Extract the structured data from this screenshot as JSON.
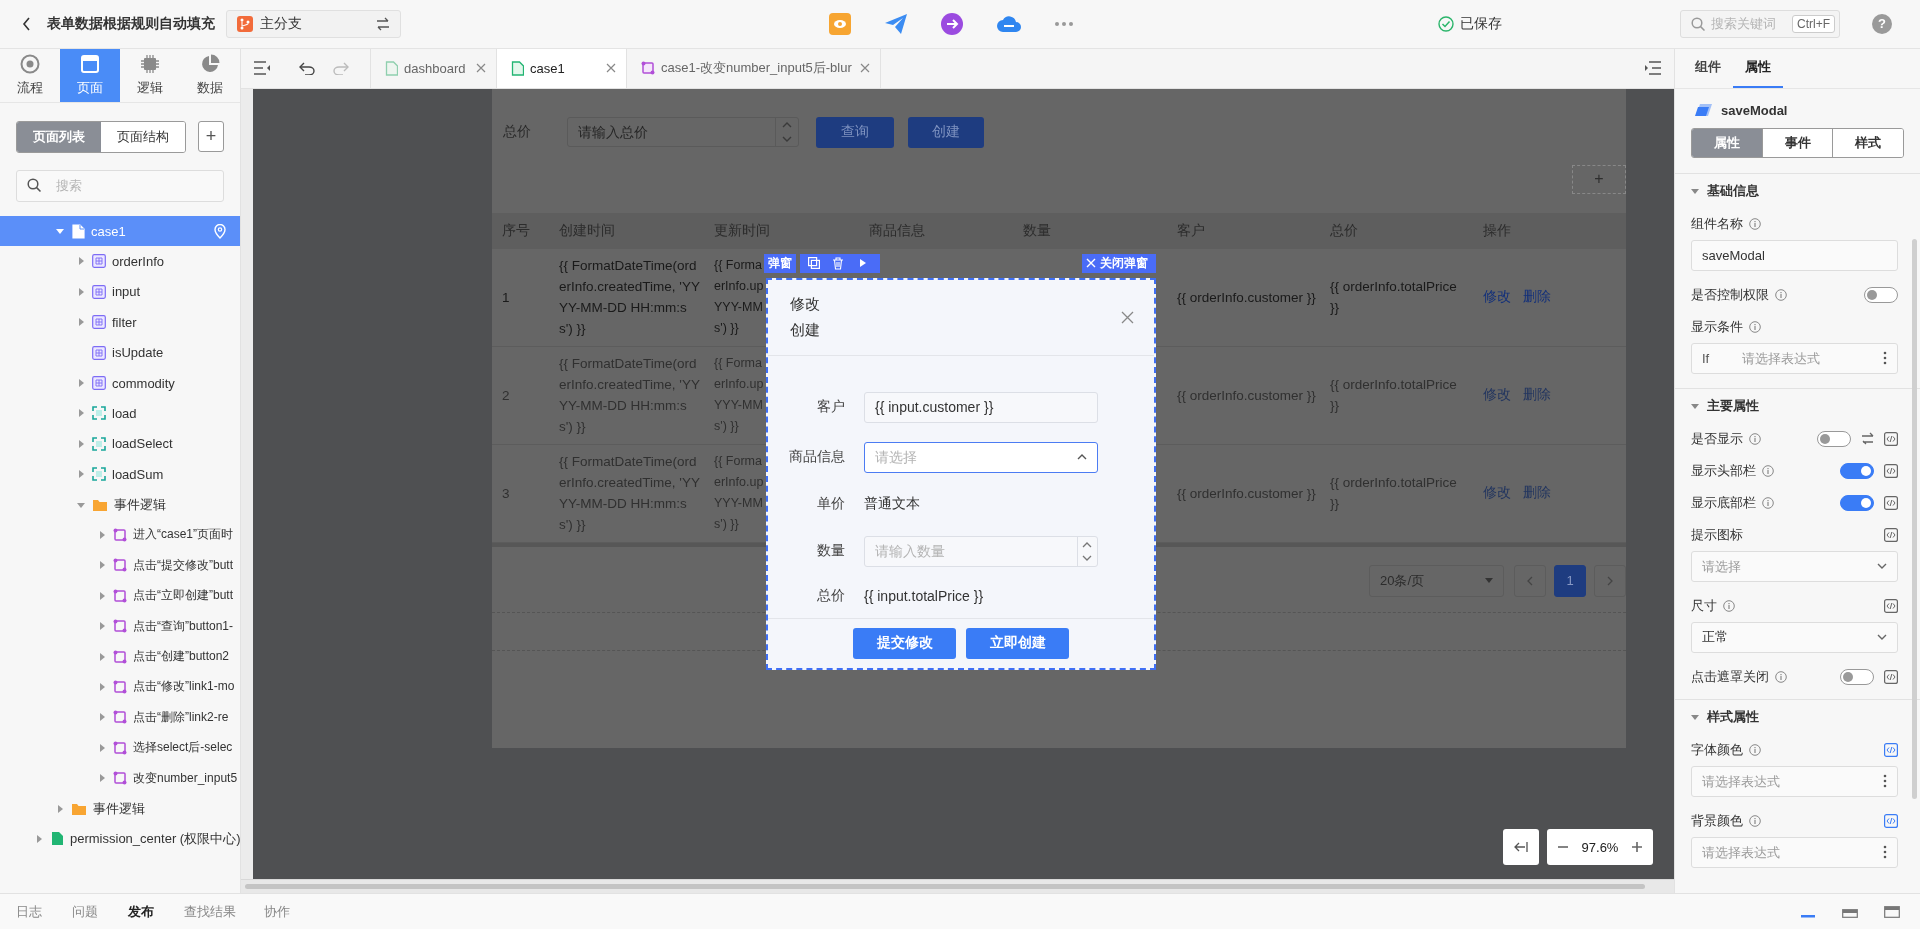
{
  "app_bar": {
    "title": "表单数据根据规则自动填充",
    "branch": "主分支",
    "save_status": "已保存",
    "search": {
      "placeholder": "搜索关键词",
      "shortcut": "Ctrl+F"
    },
    "help": "?"
  },
  "side_panel": {
    "nav_tabs": [
      {
        "label": "流程",
        "kind": "flow",
        "selected": false
      },
      {
        "label": "页面",
        "kind": "page",
        "selected": true
      },
      {
        "label": "逻辑",
        "kind": "logic",
        "selected": false
      },
      {
        "label": "数据",
        "kind": "data",
        "selected": false
      }
    ],
    "segments": [
      {
        "label": "页面列表",
        "selected": true
      },
      {
        "label": "页面结构",
        "selected": false
      }
    ],
    "add_button": "+",
    "search": {
      "placeholder": "搜索"
    },
    "tree": [
      {
        "children": [
          {
            "label": "case1",
            "kind": "page",
            "expanded": true,
            "selected": true,
            "children": [
              {
                "label": "orderInfo",
                "kind": "variable",
                "expanded": false,
                "selected": false
              },
              {
                "label": "input",
                "kind": "variable",
                "expanded": false,
                "selected": false
              },
              {
                "label": "filter",
                "kind": "variable",
                "expanded": false,
                "selected": false
              },
              {
                "label": "isUpdate",
                "kind": "variable",
                "selected": false
              },
              {
                "label": "commodity",
                "kind": "variable",
                "expanded": false,
                "selected": false
              },
              {
                "label": "load",
                "kind": "action",
                "expanded": false,
                "selected": false
              },
              {
                "label": "loadSelect",
                "kind": "action",
                "expanded": false,
                "selected": false
              },
              {
                "label": "loadSum",
                "kind": "action",
                "expanded": false,
                "selected": false
              },
              {
                "label": "事件逻辑",
                "kind": "folder",
                "expanded": true,
                "selected": false,
                "children": [
                  {
                    "label": "进入“case1”页面时",
                    "kind": "event",
                    "expanded": false,
                    "selected": false
                  },
                  {
                    "label": "点击“提交修改”butt",
                    "kind": "event",
                    "expanded": false,
                    "selected": false
                  },
                  {
                    "label": "点击“立即创建”butt",
                    "kind": "event",
                    "expanded": false,
                    "selected": false
                  },
                  {
                    "label": "点击“查询”button1-",
                    "kind": "event",
                    "expanded": false,
                    "selected": false
                  },
                  {
                    "label": "点击“创建”button2",
                    "kind": "event",
                    "expanded": false,
                    "selected": false
                  },
                  {
                    "label": "点击“修改”link1-mo",
                    "kind": "event",
                    "expanded": false,
                    "selected": false
                  },
                  {
                    "label": "点击“删除”link2-re",
                    "kind": "event",
                    "expanded": false,
                    "selected": false
                  },
                  {
                    "label": "选择select后-selec",
                    "kind": "event",
                    "expanded": false,
                    "selected": false
                  },
                  {
                    "label": "改变number_input5",
                    "kind": "event",
                    "expanded": false,
                    "selected": false
                  }
                ]
              }
            ]
          },
          {
            "label": "事件逻辑",
            "kind": "folder",
            "expanded": false,
            "selected": false
          }
        ]
      },
      {
        "label": "permission_center (权限中心)",
        "kind": "module",
        "expanded": false,
        "selected": false
      }
    ]
  },
  "editor_tabs": [
    {
      "label": "dashboard",
      "kind": "page",
      "selected": false
    },
    {
      "label": "case1",
      "kind": "page",
      "selected": true
    },
    {
      "label": "case1-改变number_input5后-blur",
      "kind": "logic",
      "selected": false
    }
  ],
  "preview": {
    "filter": {
      "label": "总价",
      "placeholder": "请输入总价",
      "buttons": [
        "查询",
        "创建"
      ]
    },
    "add_slot": "+",
    "table": {
      "columns": [
        "序号",
        "创建时间",
        "更新时间",
        "商品信息",
        "数量",
        "客户",
        "总价",
        "操作"
      ],
      "rows": [
        {
          "index": "1",
          "created": "{{ FormatDateTime(orderInfo.createdTime, 'YYYY-MM-DD HH:mm:ss') }}",
          "updated": "{{ Forma\nerInfo.up\nYYY-MM\ns') }}",
          "customer": "{{ orderInfo.customer }}",
          "total": "{{ orderInfo.totalPrice }}",
          "actions": [
            "修改",
            "删除"
          ],
          "disabled": false
        },
        {
          "index": "2",
          "created": "{{ FormatDateTime(orderInfo.createdTime, 'YYYY-MM-DD HH:mm:ss') }}",
          "updated": "{{ Forma\nerInfo.up\nYYY-MM\ns') }}",
          "customer": "{{ orderInfo.customer }}",
          "total": "{{ orderInfo.totalPrice }}",
          "actions": [
            "修改",
            "删除"
          ],
          "disabled": true
        },
        {
          "index": "3",
          "created": "{{ FormatDateTime(orderInfo.createdTime, 'YYYY-MM-DD HH:mm:ss') }}",
          "updated": "{{ Forma\nerInfo.up\nYYY-MM\ns') }}",
          "customer": "{{ orderInfo.customer }}",
          "total": "{{ orderInfo.totalPrice }}",
          "actions": [
            "修改",
            "删除"
          ],
          "disabled": true
        }
      ]
    },
    "pagination": {
      "page_size": "20条/页",
      "pages": [
        {
          "label": "1",
          "selected": true
        }
      ]
    }
  },
  "modal": {
    "tag": "弹窗",
    "close_label": "关闭弹窗",
    "title_lines": [
      "修改",
      "创建"
    ],
    "fields": [
      {
        "kind": "input",
        "label": "客户",
        "value": "{{ input.customer }}"
      },
      {
        "kind": "select",
        "label": "商品信息",
        "placeholder": "请选择",
        "expanded": true
      },
      {
        "kind": "text",
        "label": "单价",
        "value": "普通文本"
      },
      {
        "kind": "number",
        "label": "数量",
        "placeholder": "请输入数量"
      },
      {
        "kind": "text",
        "label": "总价",
        "value": "{{ input.totalPrice }}"
      }
    ],
    "buttons": [
      "提交修改",
      "立即创建"
    ]
  },
  "zoom": {
    "reading": "97.6%"
  },
  "inspector": {
    "tabs": [
      {
        "label": "组件",
        "selected": false
      },
      {
        "label": "属性",
        "selected": true
      }
    ],
    "component": "saveModal",
    "segments": [
      {
        "label": "属性",
        "selected": true
      },
      {
        "label": "事件",
        "selected": false
      },
      {
        "label": "样式",
        "selected": false
      }
    ],
    "sections": [
      {
        "title": "基础信息",
        "expanded": true,
        "props": [
          {
            "kind": "input",
            "label": "组件名称",
            "info": true,
            "value": "saveModal"
          },
          {
            "kind": "toggle",
            "label": "是否控制权限",
            "info": true,
            "on": false
          },
          {
            "kind": "expression",
            "label": "显示条件",
            "info": true,
            "prefix": "If",
            "placeholder": "请选择表达式"
          }
        ]
      },
      {
        "title": "主要属性",
        "expanded": true,
        "props": [
          {
            "kind": "toggle",
            "label": "是否显示",
            "info": true,
            "on": false,
            "swap": true,
            "bound": false
          },
          {
            "kind": "toggle",
            "label": "显示头部栏",
            "info": true,
            "on": true,
            "bound": false
          },
          {
            "kind": "toggle",
            "label": "显示底部栏",
            "info": true,
            "on": true,
            "bound": false
          },
          {
            "kind": "select",
            "label": "提示图标",
            "info": false,
            "placeholder": "请选择",
            "bound": false
          },
          {
            "kind": "select",
            "label": "尺寸",
            "info": true,
            "value": "正常",
            "bound": false
          },
          {
            "kind": "toggle",
            "label": "点击遮罩关闭",
            "info": true,
            "on": false,
            "bound": false
          }
        ]
      },
      {
        "title": "样式属性",
        "expanded": true,
        "props": [
          {
            "kind": "expression",
            "label": "字体颜色",
            "info": true,
            "placeholder": "请选择表达式",
            "bound": true
          },
          {
            "kind": "expression",
            "label": "背景颜色",
            "info": true,
            "placeholder": "请选择表达式",
            "bound": true
          }
        ]
      }
    ]
  },
  "bottom_bar": {
    "tabs": [
      {
        "label": "日志",
        "selected": false
      },
      {
        "label": "问题",
        "selected": false
      },
      {
        "label": "发布",
        "selected": true
      },
      {
        "label": "查找结果",
        "selected": false
      },
      {
        "label": "协作",
        "selected": false
      }
    ],
    "layout_buttons": [
      {
        "kind": "minimized",
        "selected": true
      },
      {
        "kind": "half",
        "selected": false
      },
      {
        "kind": "full",
        "selected": false
      }
    ]
  }
}
